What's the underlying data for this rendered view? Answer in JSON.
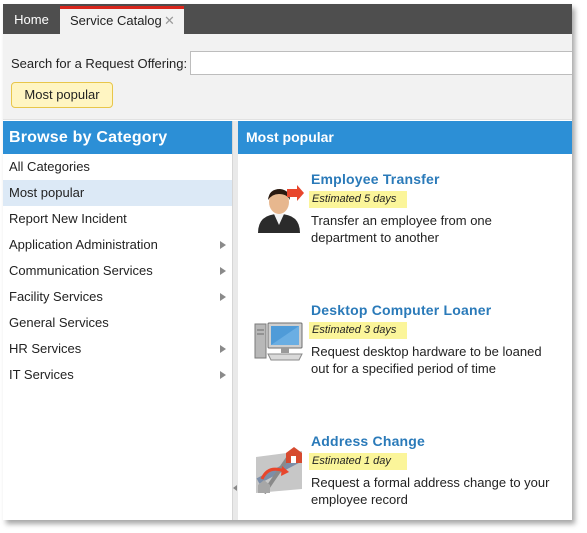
{
  "tabs": {
    "home": "Home",
    "catalog": "Service Catalog",
    "close_glyph": "✕"
  },
  "search": {
    "label": "Search for a Request Offering:",
    "value": "",
    "placeholder": "",
    "chip": "Most popular"
  },
  "left_pane": {
    "title": "Browse by Category",
    "selected": "Most popular",
    "items": [
      {
        "label": "All Categories",
        "has_submenu": false
      },
      {
        "label": "Most popular",
        "has_submenu": false
      },
      {
        "label": "Report New Incident",
        "has_submenu": false
      },
      {
        "label": "Application Administration",
        "has_submenu": true
      },
      {
        "label": "Communication Services",
        "has_submenu": true
      },
      {
        "label": "Facility Services",
        "has_submenu": true
      },
      {
        "label": "General Services",
        "has_submenu": false
      },
      {
        "label": "HR Services",
        "has_submenu": true
      },
      {
        "label": "IT Services",
        "has_submenu": true
      }
    ]
  },
  "right_pane": {
    "title": "Most popular",
    "offerings": [
      {
        "title": "Employee Transfer",
        "estimate": "Estimated 5 days",
        "description": "Transfer an employee from one department to another",
        "icon": "person-transfer-icon"
      },
      {
        "title": "Desktop Computer Loaner",
        "estimate": "Estimated 3 days",
        "description": "Request desktop hardware to be loaned out for a specified period of time",
        "icon": "desktop-computer-icon"
      },
      {
        "title": "Address Change",
        "estimate": "Estimated 1 day",
        "description": "Request a formal address change to your employee record",
        "icon": "address-map-icon"
      }
    ]
  },
  "colors": {
    "header_blue": "#2c8fd6",
    "link_blue": "#2a7ab9",
    "highlight_yellow": "#fbf59a",
    "tab_red": "#d9261c",
    "tab_bar": "#4e4e4e"
  }
}
